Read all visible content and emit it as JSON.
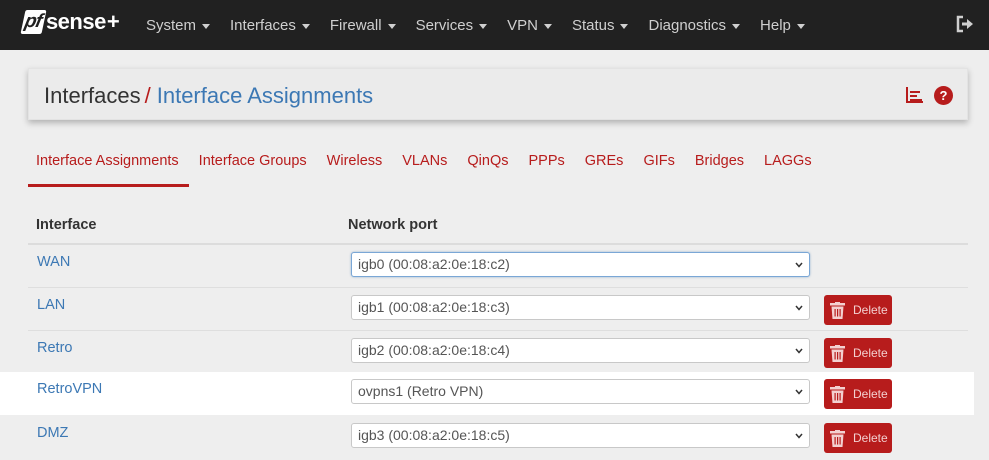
{
  "brand": {
    "logo_pf": "pf",
    "logo_sense": "sense",
    "logo_plus": "+"
  },
  "nav": {
    "items": [
      {
        "label": "System"
      },
      {
        "label": "Interfaces"
      },
      {
        "label": "Firewall"
      },
      {
        "label": "Services"
      },
      {
        "label": "VPN"
      },
      {
        "label": "Status"
      },
      {
        "label": "Diagnostics"
      },
      {
        "label": "Help"
      }
    ],
    "logout_icon": "sign-out-icon"
  },
  "header": {
    "breadcrumb_root": "Interfaces",
    "breadcrumb_sep": "/",
    "breadcrumb_current": "Interface Assignments",
    "chart_icon": "bar-chart-icon",
    "help_icon_glyph": "?"
  },
  "tabs": [
    {
      "label": "Interface Assignments",
      "active": true
    },
    {
      "label": "Interface Groups"
    },
    {
      "label": "Wireless"
    },
    {
      "label": "VLANs"
    },
    {
      "label": "QinQs"
    },
    {
      "label": "PPPs"
    },
    {
      "label": "GREs"
    },
    {
      "label": "GIFs"
    },
    {
      "label": "Bridges"
    },
    {
      "label": "LAGGs"
    }
  ],
  "table": {
    "headers": {
      "interface": "Interface",
      "port": "Network port"
    },
    "rows": [
      {
        "interface": "WAN",
        "port": "igb0 (00:08:a2:0e:18:c2)",
        "delete": ""
      },
      {
        "interface": "LAN",
        "port": "igb1 (00:08:a2:0e:18:c3)",
        "delete": "Delete"
      },
      {
        "interface": "Retro",
        "port": "igb2 (00:08:a2:0e:18:c4)",
        "delete": "Delete"
      },
      {
        "interface": "RetroVPN",
        "port": "ovpns1 (Retro VPN)",
        "delete": "Delete"
      },
      {
        "interface": "DMZ",
        "port": "igb3 (00:08:a2:0e:18:c5)",
        "delete": "Delete"
      }
    ]
  },
  "colors": {
    "brand_red": "#b71c1c",
    "link_blue": "#3c78b4",
    "navbar": "#212121"
  }
}
